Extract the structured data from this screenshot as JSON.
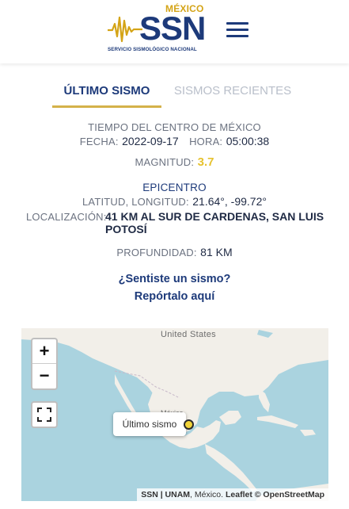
{
  "header": {
    "logo_country": "MÉXICO",
    "logo_name": "SSN",
    "logo_subtitle": "SERVICIO SISMOLÓGICO NACIONAL",
    "brand_color": "#1d3a7a",
    "accent_color": "#d4a417",
    "menu_icon": "hamburger-menu-icon"
  },
  "tabs": [
    {
      "label": "ÚLTIMO SISMO",
      "active": true
    },
    {
      "label": "SISMOS RECIENTES",
      "active": false
    }
  ],
  "quake": {
    "time_zone_label": "TIEMPO DEL CENTRO DE MÉXICO",
    "date_label": "FECHA:",
    "date_value": "2022-09-17",
    "time_label": "HORA:",
    "time_value": "05:00:38",
    "magnitude_label": "MAGNITUD:",
    "magnitude_value": "3.7",
    "epicenter_heading": "EPICENTRO",
    "latlon_label": "LATITUD, LONGITUD:",
    "latlon_value": "21.64°, -99.72°",
    "location_label": "LOCALIZACIÓN:",
    "location_value": "41 KM AL SUR DE CARDENAS, SAN LUIS POTOSÍ",
    "depth_label": "PROFUNDIDAD:",
    "depth_value": "81 KM"
  },
  "report": {
    "question": "¿Sentiste un sismo?",
    "link": "Repórtalo aquí"
  },
  "map": {
    "zoom_in": "+",
    "zoom_out": "−",
    "fullscreen_icon": "fullscreen-icon",
    "country_label_us": "United States",
    "country_label_mx": "México",
    "popup_text": "Último sismo",
    "attribution_ssn": "SSN | UNAM",
    "attribution_rest": ", México. ",
    "attribution_leaflet": "Leaflet",
    "attribution_osm": " © OpenStreetMap",
    "marker_color": "#f2d43a"
  }
}
